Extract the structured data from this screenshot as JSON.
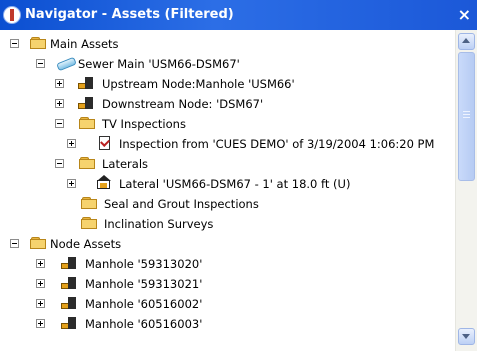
{
  "window": {
    "title": "Navigator - Assets (Filtered)",
    "close_glyph": "×"
  },
  "tree": {
    "main_assets": "Main Assets",
    "sewer_main": "Sewer Main 'USM66-DSM67'",
    "upstream_node": "Upstream Node:Manhole 'USM66'",
    "downstream_node": "Downstream Node: 'DSM67'",
    "tv_inspections": "TV Inspections",
    "inspection": "Inspection from 'CUES DEMO' of 3/19/2004 1:06:20 PM",
    "laterals": "Laterals",
    "lateral": "Lateral 'USM66-DSM67 - 1' at 18.0 ft (U)",
    "seal_grout": "Seal and Grout Inspections",
    "inclination": "Inclination Surveys",
    "node_assets": "Node Assets",
    "manhole_1": "Manhole '59313020'",
    "manhole_2": "Manhole '59313021'",
    "manhole_3": "Manhole '60516002'",
    "manhole_4": "Manhole '60516003'"
  },
  "icons": {
    "folder": "folder-icon",
    "pipe": "sewer-main-icon",
    "manhole": "manhole-icon",
    "inspection": "inspection-icon",
    "lateral": "lateral-icon"
  }
}
